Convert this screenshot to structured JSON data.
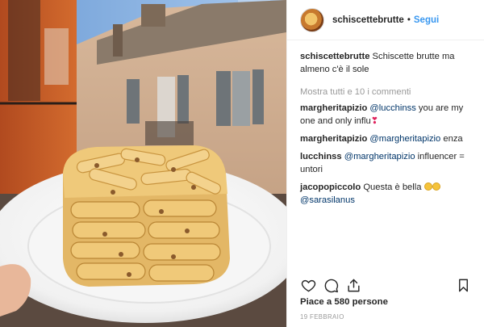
{
  "post": {
    "author": "schiscettebrutte",
    "follow_label": "Segui",
    "caption_text": "Schiscette brutte ma almeno c'è il sole",
    "show_all_comments": "Mostra tutti e 10 i commenti",
    "comments": [
      {
        "user": "margheritapizio",
        "mention": "@lucchinss",
        "text": " you are my one and only influ"
      },
      {
        "user": "margheritapizio",
        "mention": "@margheritapizio",
        "text": " enza"
      },
      {
        "user": "lucchinss",
        "mention": "@margheritapizio",
        "text": " influencer = untori"
      },
      {
        "user": "jacopopiccolo",
        "text_before": " Questa è bella ",
        "mention_after": "@sarasilanus"
      }
    ],
    "likes": "Piace a 580 persone",
    "date": "19 FEBBRAIO"
  },
  "icons": {
    "like": "heart-icon",
    "comment": "comment-icon",
    "share": "share-icon",
    "save": "bookmark-icon"
  },
  "colors": {
    "follow": "#3897f0",
    "mention": "#003569",
    "muted": "#999999",
    "text": "#262626"
  }
}
